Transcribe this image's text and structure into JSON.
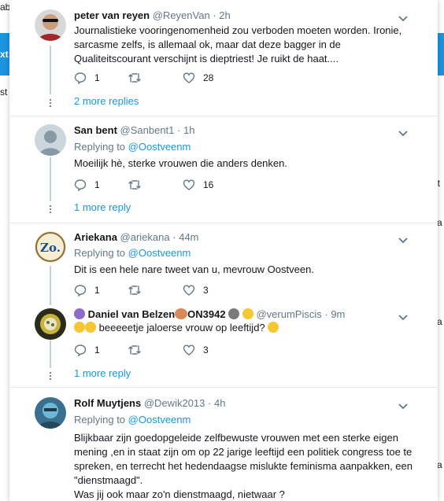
{
  "background": {
    "left_fragments": [
      "ab",
      "xt",
      "st"
    ],
    "right_fragments": [
      "et",
      "sa",
      "sa",
      "sa"
    ]
  },
  "tweets": [
    {
      "name": "peter van reyen",
      "handle": "@ReyenVan",
      "time": "2h",
      "text": "Journalistieke vooringenomenheid zou verboden moeten worden. Ironie, sarcasme zelfs, is allemaal ok, maar dat deze bagger in de Qualiteitscourant verschijnt is dieptriest! Je ruikt de haat....",
      "replies": "1",
      "retweets": "",
      "likes": "28",
      "more_replies": "2 more replies"
    },
    {
      "name": "San bent",
      "handle": "@Sanbent1",
      "time": "1h",
      "replying_prefix": "Replying to",
      "replying_to": "@Oostveenm",
      "text": "Moeilijk hè, sterke vrouwen die anders denken.",
      "replies": "1",
      "retweets": "",
      "likes": "16",
      "more_replies": "1 more reply"
    },
    {
      "name": "Ariekana",
      "handle": "@ariekana",
      "time": "44m",
      "replying_prefix": "Replying to",
      "replying_to": "@Oostveenm",
      "avatar_text": "Zo.",
      "text": "Dit is een hele nare tweet van u, mevrouw Oostveen.",
      "replies": "1",
      "retweets": "",
      "likes": "3"
    },
    {
      "name": "Daniel van Belzen",
      "name_suffix": "ON3942",
      "handle": "@verumPiscis",
      "time": "9m",
      "text": "beeeeetje jaloerse vrouw op leeftijd?",
      "replies": "1",
      "retweets": "",
      "likes": "3",
      "more_replies": "1 more reply"
    },
    {
      "name": "Rolf Muytjens",
      "handle": "@Dewik2013",
      "time": "4h",
      "replying_prefix": "Replying to",
      "replying_to": "@Oostveenm",
      "text_lines": [
        "Blijkbaar zijn goedopgeleide zelfbewuste vrouwen met een sterke eigen",
        "mening ,en in staat zijn om op 22 jarige leeftijd een politiek congress toe te",
        "spreken, en terrecht het hedendaagse mislukte feminisma aanpakken, een",
        "\"dienstmaagd\".",
        "Was jij ook maar zo'n dienstmaagd, nietwaar ?"
      ]
    }
  ],
  "separator": "·",
  "colors": {
    "link": "#1b95e0",
    "muted": "#657786",
    "text": "#14171a",
    "thread_line": "#c4cfd6",
    "like_accent": "#e0245e"
  },
  "icons": {
    "reply": "reply-icon",
    "retweet": "retweet-icon",
    "like": "heart-icon",
    "caret": "chevron-down-icon",
    "thread_dots": "vertical-dots-icon"
  }
}
